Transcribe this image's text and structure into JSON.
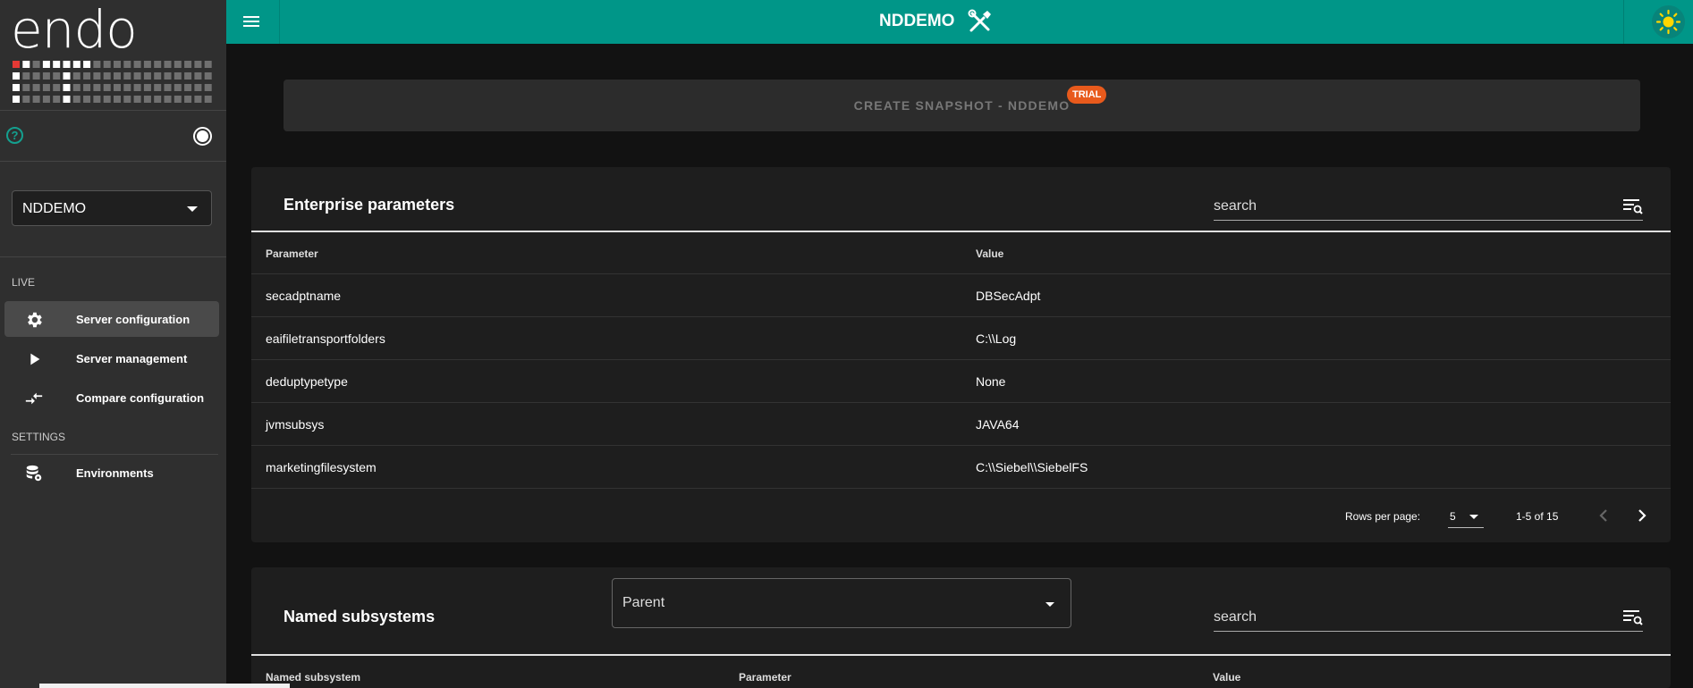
{
  "brand": {
    "logo_text": "endo"
  },
  "sidebar": {
    "environment_select": "NDDEMO",
    "sections": [
      {
        "label": "LIVE"
      },
      {
        "label": "SETTINGS"
      }
    ],
    "items": [
      {
        "label": "Server configuration",
        "icon": "gear-icon",
        "active": true
      },
      {
        "label": "Server management",
        "icon": "play-icon",
        "active": false
      },
      {
        "label": "Compare configuration",
        "icon": "compare-arrows-icon",
        "active": false
      },
      {
        "label": "Environments",
        "icon": "database-settings-icon",
        "active": false
      }
    ]
  },
  "topbar": {
    "title": "NDDEMO"
  },
  "snapshot": {
    "label": "CREATE SNAPSHOT - NDDEMO",
    "badge": "TRIAL"
  },
  "enterprise": {
    "title": "Enterprise parameters",
    "search_placeholder": "search",
    "columns": [
      "Parameter",
      "Value"
    ],
    "rows": [
      [
        "secadptname",
        "DBSecAdpt"
      ],
      [
        "eaifiletransportfolders",
        "C:\\\\Log"
      ],
      [
        "deduptypetype",
        "None"
      ],
      [
        "jvmsubsys",
        "JAVA64"
      ],
      [
        "marketingfilesystem",
        "C:\\\\Siebel\\\\SiebelFS"
      ]
    ],
    "pagination": {
      "rows_per_page_label": "Rows per page:",
      "rows_per_page": "5",
      "range": "1-5 of 15"
    }
  },
  "subsystems": {
    "title": "Named subsystems",
    "parent_select": "Parent",
    "search_placeholder": "search",
    "columns": [
      "Named subsystem",
      "Parameter",
      "Value"
    ]
  },
  "colors": {
    "accent": "#009688",
    "badge": "#e85a1c",
    "sidebar": "#2f2f2f"
  }
}
